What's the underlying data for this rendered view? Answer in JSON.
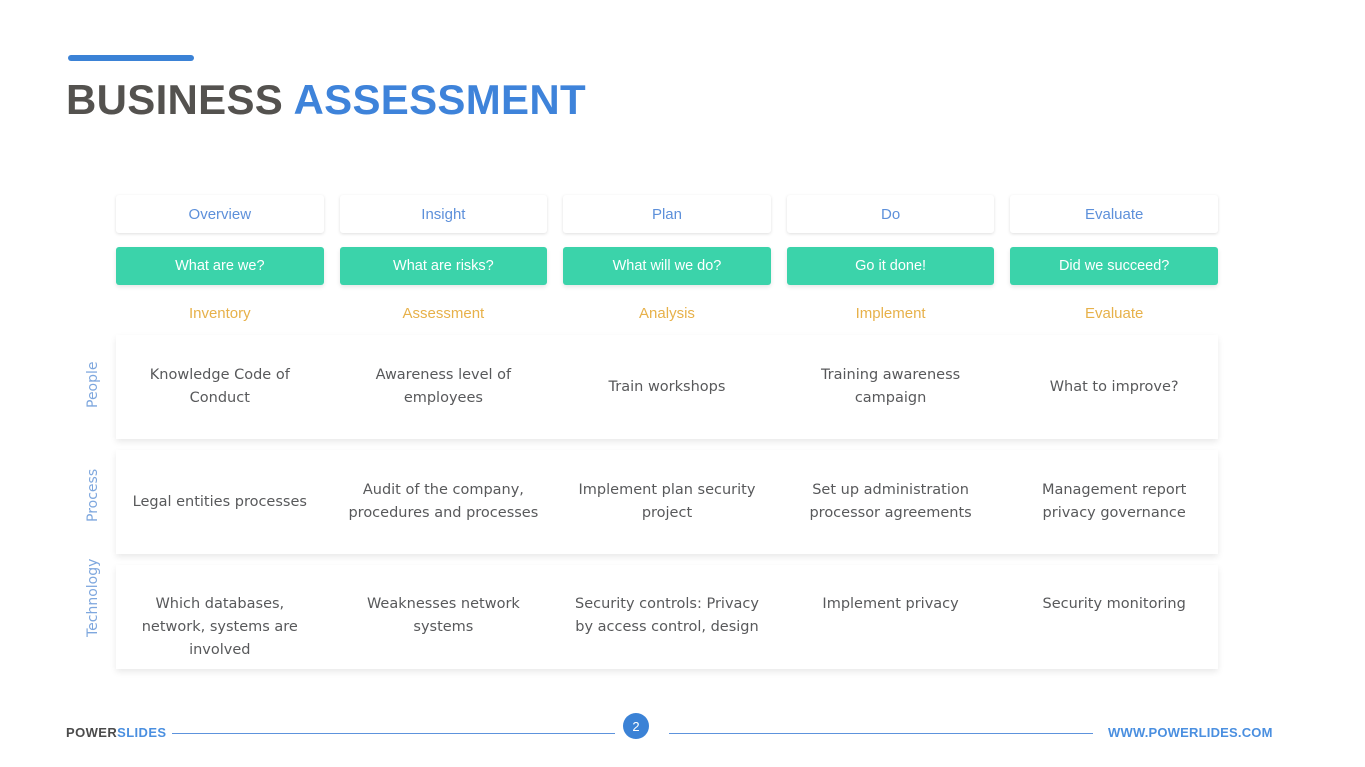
{
  "title": {
    "part1": "BUSINESS ",
    "part2": "ASSESSMENT",
    "accent_color": "#3b82d6",
    "part1_color": "#54524f",
    "part2_color": "#3e83da"
  },
  "matrix": {
    "columns": [
      {
        "overview": "Overview",
        "question": "What are we?",
        "stage": "Inventory"
      },
      {
        "overview": "Insight",
        "question": "What are risks?",
        "stage": "Assessment"
      },
      {
        "overview": "Plan",
        "question": "What will we do?",
        "stage": "Analysis"
      },
      {
        "overview": "Do",
        "question": "Go it done!",
        "stage": "Implement"
      },
      {
        "overview": "Evaluate",
        "question": "Did we succeed?",
        "stage": "Evaluate"
      }
    ],
    "rows": [
      {
        "label": "People",
        "cells": [
          "Knowledge Code of Conduct",
          "Awareness level of employees",
          "Train workshops",
          "Training awareness campaign",
          "What to improve?"
        ]
      },
      {
        "label": "Process",
        "cells": [
          "Legal entities processes",
          "Audit of the company, procedures and processes",
          "Implement plan security project",
          "Set up administration processor agreements",
          "Management report privacy governance"
        ]
      },
      {
        "label": "Technology",
        "cells": [
          "Which databases, network, systems are involved",
          "Weaknesses network systems",
          "Security controls: Privacy by access control, design",
          "Implement privacy",
          "Security monitoring"
        ]
      }
    ],
    "colors": {
      "header_text": "#5d90da",
      "question_bg": "#3bd3aa",
      "question_text": "#ffffff",
      "stage_text": "#e7b14a",
      "row_label_text": "#7ea7de",
      "body_text": "#58595b"
    }
  },
  "footer": {
    "brand_part1": "POWER",
    "brand_part2": "SLIDES",
    "page_number": "2",
    "url": "WWW.POWERLIDES.COM",
    "rule_color": "#5d93dd",
    "page_badge_color": "#3b82d6"
  }
}
